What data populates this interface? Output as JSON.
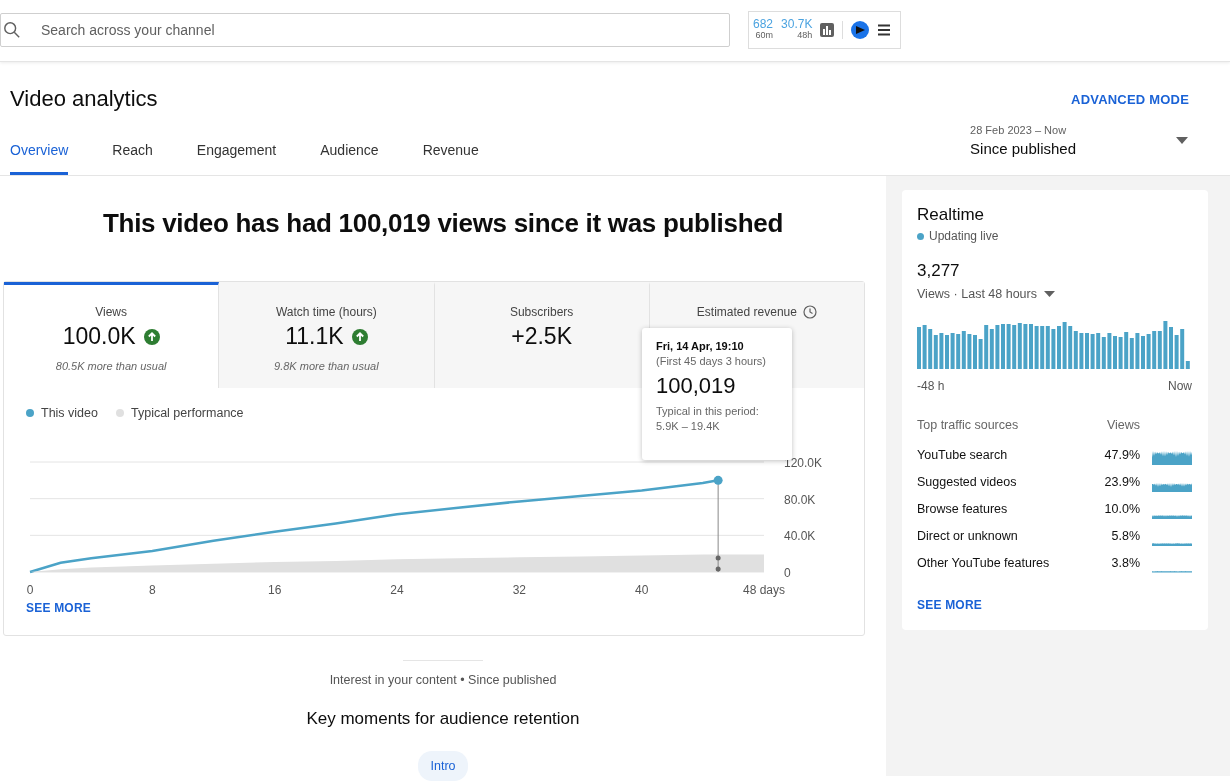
{
  "search": {
    "placeholder": "Search across your channel"
  },
  "header_stats": [
    {
      "value": "682",
      "period": "60m"
    },
    {
      "value": "30.7K",
      "period": "48h"
    }
  ],
  "page": {
    "title": "Video analytics",
    "advanced_mode": "ADVANCED MODE"
  },
  "tabs": [
    {
      "label": "Overview",
      "selected": true
    },
    {
      "label": "Reach",
      "selected": false
    },
    {
      "label": "Engagement",
      "selected": false
    },
    {
      "label": "Audience",
      "selected": false
    },
    {
      "label": "Revenue",
      "selected": false
    }
  ],
  "date_range": {
    "dates": "28 Feb 2023 – Now",
    "label": "Since published"
  },
  "headline": "This video has had 100,019 views since it was published",
  "metrics": [
    {
      "label": "Views",
      "value": "100.0K",
      "trend_up": true,
      "note": "80.5K more than usual",
      "selected": true
    },
    {
      "label": "Watch time (hours)",
      "value": "11.1K",
      "trend_up": true,
      "note": "9.8K more than usual",
      "selected": false
    },
    {
      "label": "Subscribers",
      "value": "+2.5K",
      "trend_up": false,
      "selected": false
    },
    {
      "label": "Estimated revenue",
      "clock": true,
      "selected": false
    }
  ],
  "chart_data": {
    "type": "line",
    "x": [
      0,
      2,
      4,
      8,
      12,
      16,
      20,
      24,
      28,
      32,
      36,
      40,
      44,
      45,
      48
    ],
    "series": [
      {
        "name": "This video",
        "type": "line",
        "color": "#4ba3c7",
        "values": [
          0,
          10000,
          15000,
          23000,
          34000,
          44000,
          53000,
          63000,
          70000,
          77000,
          83000,
          89000,
          97000,
          100000,
          null
        ]
      },
      {
        "name": "Typical performance",
        "type": "area",
        "color": "#e0e0e0",
        "values": [
          0,
          3000,
          5000,
          7000,
          9000,
          11000,
          12000,
          14000,
          15000,
          16000,
          17000,
          18000,
          19000,
          19000,
          19000
        ]
      }
    ],
    "ref_lines": [
      {
        "axis": "x",
        "value": 45
      }
    ],
    "xlim": [
      0,
      48
    ],
    "ylim": [
      0,
      120000
    ],
    "xticks": [
      0,
      8,
      16,
      24,
      32,
      40,
      {
        "value": 48,
        "label": "48 days"
      }
    ],
    "yticks": [
      0,
      {
        "value": 40000,
        "label": "40.0K"
      },
      {
        "value": 80000,
        "label": "80.0K"
      },
      {
        "value": 120000,
        "label": "120.0K"
      }
    ]
  },
  "tooltip": {
    "date": "Fri, 14 Apr, 19:10",
    "period": "(First 45 days 3 hours)",
    "value": "100,019",
    "typical_label": "Typical in this period:",
    "typical_range": "5.9K – 19.4K"
  },
  "see_more": "SEE MORE",
  "interest": {
    "caption": "Interest in your content • Since published",
    "title": "Key moments for audience retention",
    "chip": "Intro"
  },
  "realtime": {
    "title": "Realtime",
    "status": "Updating live",
    "count": "3,277",
    "period": "Views · Last 48 hours",
    "axis_start": "-48 h",
    "axis_end": "Now",
    "sources_header": "Top traffic sources",
    "views_header": "Views",
    "sources": [
      {
        "name": "YouTube search",
        "share": "47.9%"
      },
      {
        "name": "Suggested videos",
        "share": "23.9%"
      },
      {
        "name": "Browse features",
        "share": "10.0%"
      },
      {
        "name": "Direct or unknown",
        "share": "5.8%"
      },
      {
        "name": "Other YouTube features",
        "share": "3.8%"
      }
    ],
    "see_more": "SEE MORE"
  }
}
